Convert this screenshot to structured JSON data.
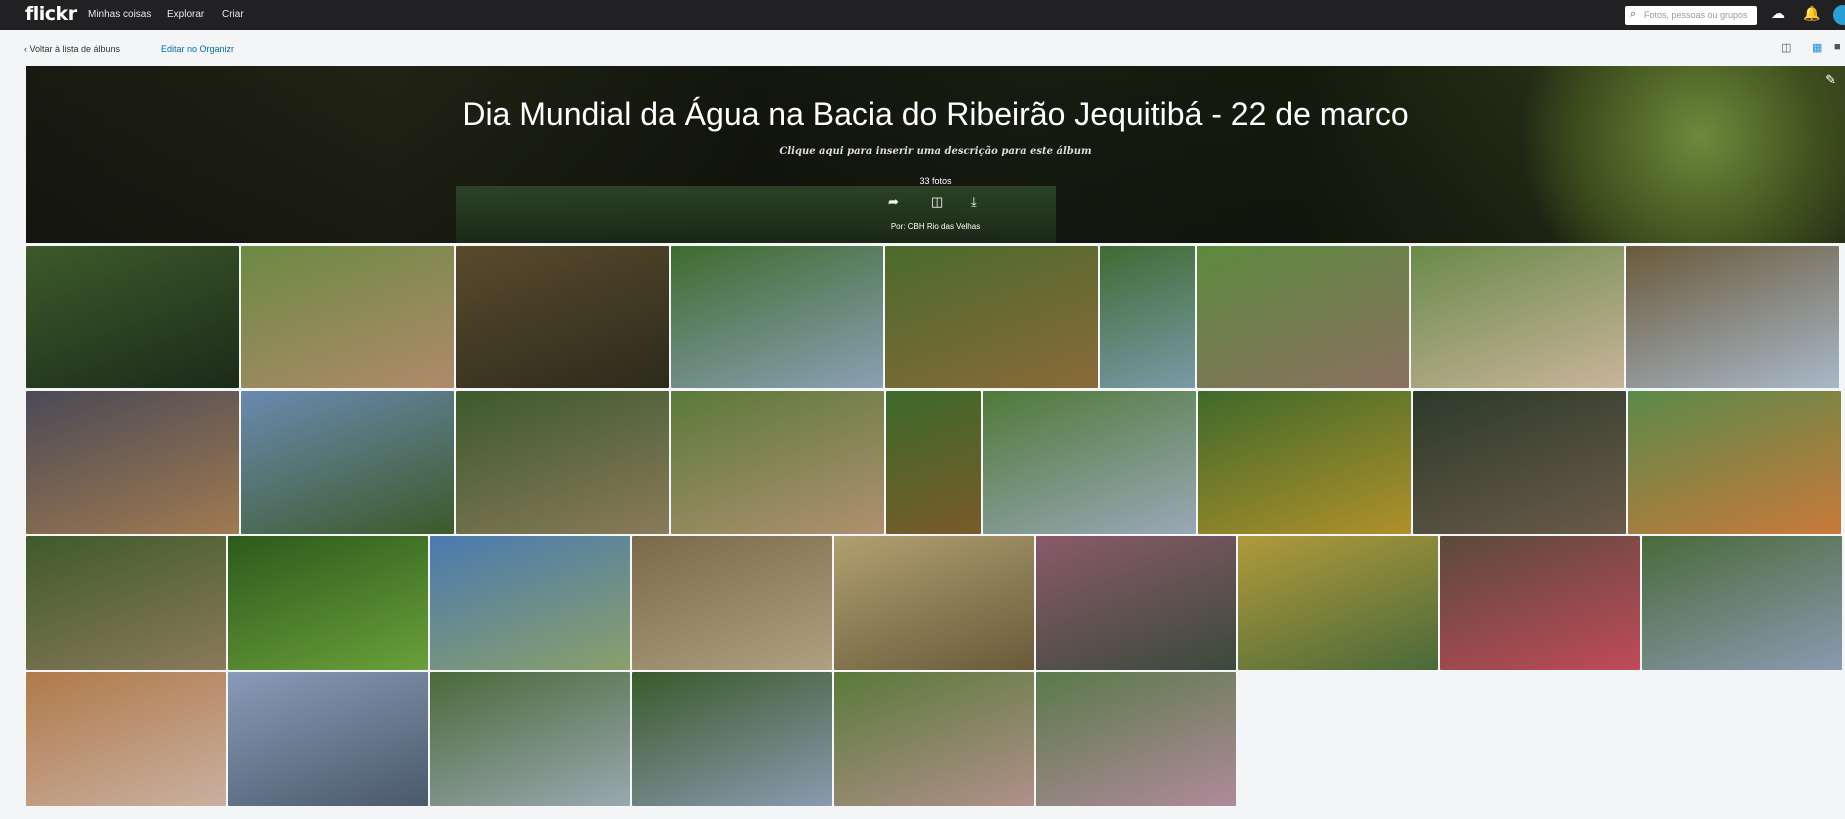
{
  "topbar": {
    "logo": "flickr",
    "nav": [
      "Minhas coisas",
      "Explorar",
      "Criar"
    ],
    "search_placeholder": "Fotos, pessoas ou grupos",
    "upload_icon": "cloud-upload-icon",
    "notification_icon": "bell-icon"
  },
  "subbar": {
    "back": "‹  Voltar à lista de álbuns",
    "edit": "Editar no Organizr",
    "slideshow_icon": "slideshow-icon",
    "grid_icon": "grid-icon"
  },
  "album": {
    "title": "Dia Mundial da Água na Bacia do Ribeirão Jequitibá - 22 de marco",
    "description": "Clique aqui para inserir uma descrição para este álbum",
    "count": "33 fotos",
    "owner": "Por: CBH Rio das Velhas",
    "actions": [
      "share-icon",
      "book-icon",
      "download-icon"
    ]
  },
  "photos": [
    {
      "name": "river-bridge",
      "c1": "#3d5a2a",
      "c2": "#1c2b1a"
    },
    {
      "name": "group-walk",
      "c1": "#6b8a43",
      "c2": "#b08a6a"
    },
    {
      "name": "stream-rocks",
      "c1": "#5a4a2c",
      "c2": "#2c2b1c"
    },
    {
      "name": "man-speaking",
      "c1": "#3f6b2e",
      "c2": "#8aa0b4"
    },
    {
      "name": "muddy-river",
      "c1": "#4a6b2c",
      "c2": "#8a6a3a"
    },
    {
      "name": "small-bridge",
      "c1": "#3f6b32",
      "c2": "#7a9aa8"
    },
    {
      "name": "man-sample",
      "c1": "#5c8a3e",
      "c2": "#8a7060"
    },
    {
      "name": "group-field",
      "c1": "#6a8a4a",
      "c2": "#c9b49a"
    },
    {
      "name": "kneeling-bucket",
      "c1": "#6a5a3a",
      "c2": "#a8b8c8"
    },
    {
      "name": "bottle-sample",
      "c1": "#4a4a56",
      "c2": "#a07a50"
    },
    {
      "name": "two-men-talk",
      "c1": "#6a8ab0",
      "c2": "#3c5a2a"
    },
    {
      "name": "stone-bridge",
      "c1": "#3c5a2c",
      "c2": "#8a7a5a"
    },
    {
      "name": "dirt-path",
      "c1": "#5a7a3a",
      "c2": "#b09070"
    },
    {
      "name": "river-trees",
      "c1": "#3c6a2a",
      "c2": "#7a5a2a"
    },
    {
      "name": "fence-group",
      "c1": "#4f7a38",
      "c2": "#9aa8b8"
    },
    {
      "name": "yellow-fence",
      "c1": "#3f6a2a",
      "c2": "#b0902a"
    },
    {
      "name": "accordion",
      "c1": "#2c3a2a",
      "c2": "#6a5a4a"
    },
    {
      "name": "orange-river",
      "c1": "#5a8a4a",
      "c2": "#c9793a"
    },
    {
      "name": "forest-group",
      "c1": "#3f5a2a",
      "c2": "#8a7a5a"
    },
    {
      "name": "butterfly",
      "c1": "#2c5a1c",
      "c2": "#6aa03a"
    },
    {
      "name": "palm-lake",
      "c1": "#4a7ab0",
      "c2": "#8aa06a"
    },
    {
      "name": "circle-seated",
      "c1": "#7a6a4a",
      "c2": "#b0a080"
    },
    {
      "name": "man-glasses",
      "c1": "#b0a070",
      "c2": "#6a5a3a"
    },
    {
      "name": "women-reading",
      "c1": "#8a5a6a",
      "c2": "#3a4a3a"
    },
    {
      "name": "yellow-chairs",
      "c1": "#b09a3a",
      "c2": "#4a6a3a"
    },
    {
      "name": "brochure-table",
      "c1": "#5a4a3a",
      "c2": "#c04a5a"
    },
    {
      "name": "man-brochure",
      "c1": "#4a6a3a",
      "c2": "#8a9ab0"
    },
    {
      "name": "woman-brochure",
      "c1": "#b07a4a",
      "c2": "#c9b0a0"
    },
    {
      "name": "brochures-hands",
      "c1": "#8a9ab8",
      "c2": "#4a5a6a"
    },
    {
      "name": "tables-shade",
      "c1": "#4a6a3a",
      "c2": "#9aa8b0"
    },
    {
      "name": "man-standing",
      "c1": "#3a5a2a",
      "c2": "#8a9ab0"
    },
    {
      "name": "group-photo",
      "c1": "#5a7a3a",
      "c2": "#b0908a"
    },
    {
      "name": "three-women",
      "c1": "#5a7a4a",
      "c2": "#b08a9a"
    }
  ]
}
